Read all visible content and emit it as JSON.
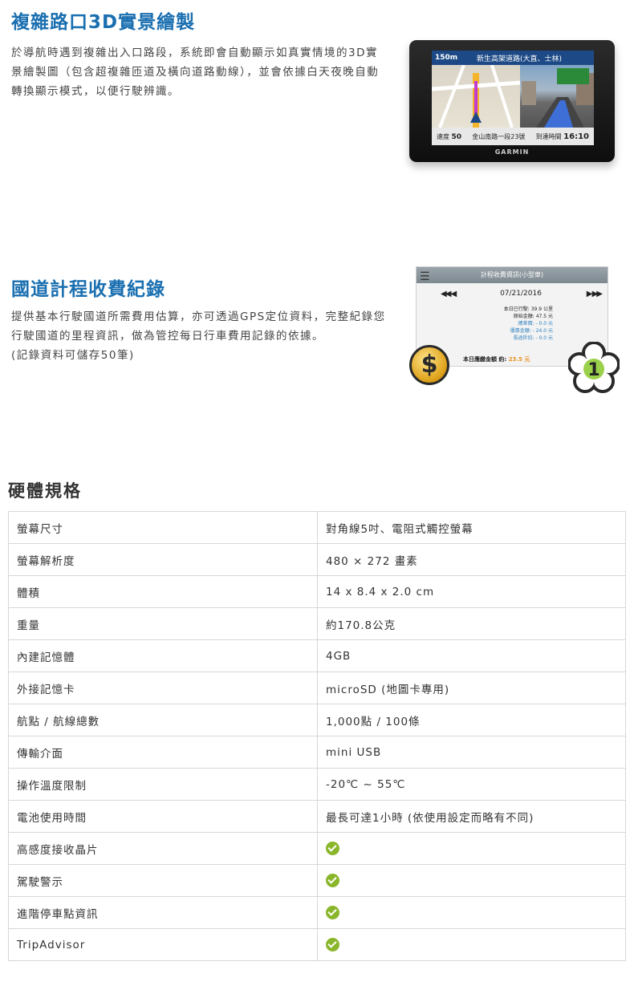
{
  "feature1": {
    "title": "複雜路口3D實景繪製",
    "desc": "於導航時遇到複雜出入口路段，系統即會自動顯示如真實情境的3D實景繪製圖（包含超複雜匝道及橫向道路動線），並會依據白天夜晚自動轉換顯示模式，以便行駛辨識。"
  },
  "device": {
    "distance": "150m",
    "road": "新生高架道路(大直、士林)",
    "speed_label": "速度",
    "speed": "50",
    "street": "金山南路一段23號",
    "arrival_label": "到達時間",
    "arrival": "16:10",
    "brand": "GARMIN"
  },
  "feature2": {
    "title": "國道計程收費紀錄",
    "desc": "提供基本行駛國道所需費用估算，亦可透過GPS定位資料，完整紀錄您行駛國道的里程資訊，做為管控每日行車費用記錄的依據。",
    "note": "(記錄資料可儲存50筆)"
  },
  "toll": {
    "header": "計程收費資訊(小型車)",
    "date": "07/21/2016",
    "rows": [
      {
        "label": "本日已行駛: 39.9 公里",
        "style": "normal"
      },
      {
        "label": "原始金額: 47.5 元",
        "style": "normal"
      },
      {
        "label": "總差價: - 0.0 元",
        "style": "green"
      },
      {
        "label": "優惠金額: - 24.0 元",
        "style": "green"
      },
      {
        "label": "長途折扣: - 0.0 元",
        "style": "green"
      }
    ],
    "total_label": "本日應繳金額 約:",
    "total_value": "23.5 元",
    "coin_symbol": "$",
    "badge_number": "1"
  },
  "spec": {
    "title": "硬體規格",
    "rows": [
      {
        "label": "螢幕尺寸",
        "value": "對角線5吋、電阻式觸控螢幕",
        "check": false
      },
      {
        "label": "螢幕解析度",
        "value": "480 × 272 畫素",
        "check": false
      },
      {
        "label": "體積",
        "value": "14 x 8.4 x 2.0 cm",
        "check": false
      },
      {
        "label": "重量",
        "value": "約170.8公克",
        "check": false
      },
      {
        "label": "內建記憶體",
        "value": "4GB",
        "check": false
      },
      {
        "label": "外接記憶卡",
        "value": "microSD (地圖卡專用)",
        "check": false
      },
      {
        "label": "航點 / 航線總數",
        "value": "1,000點 / 100條",
        "check": false
      },
      {
        "label": "傳輸介面",
        "value": "mini USB",
        "check": false
      },
      {
        "label": "操作溫度限制",
        "value": "-20℃ ~ 55℃",
        "check": false
      },
      {
        "label": "電池使用時間",
        "value": "最長可達1小時 (依使用設定而略有不同)",
        "check": false
      },
      {
        "label": "高感度接收晶片",
        "value": "",
        "check": true
      },
      {
        "label": "駕駛警示",
        "value": "",
        "check": true
      },
      {
        "label": "進階停車點資訊",
        "value": "",
        "check": true
      },
      {
        "label": "TripAdvisor",
        "value": "",
        "check": true
      }
    ]
  },
  "colors": {
    "title_blue": "#1a6fb0",
    "check_green": "#8ab62b"
  }
}
